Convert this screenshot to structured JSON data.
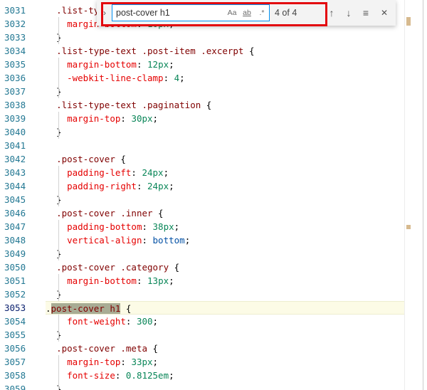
{
  "editor": {
    "lines": [
      {
        "n": "3031",
        "parts": [
          {
            "t": "  "
          },
          {
            "t": ".list-ty",
            "c": "sel"
          }
        ]
      },
      {
        "n": "3032",
        "parts": [
          {
            "t": "    "
          },
          {
            "t": "margin-bottom",
            "c": "prop"
          },
          {
            "t": ": "
          },
          {
            "t": "10px",
            "c": "num"
          },
          {
            "t": ";"
          }
        ]
      },
      {
        "n": "3033",
        "parts": [
          {
            "t": "  }"
          }
        ]
      },
      {
        "n": "3034",
        "parts": [
          {
            "t": "  "
          },
          {
            "t": ".list-type-text .post-item .excerpt",
            "c": "sel"
          },
          {
            "t": " {"
          }
        ]
      },
      {
        "n": "3035",
        "parts": [
          {
            "t": "    "
          },
          {
            "t": "margin-bottom",
            "c": "prop"
          },
          {
            "t": ": "
          },
          {
            "t": "12px",
            "c": "num"
          },
          {
            "t": ";"
          }
        ]
      },
      {
        "n": "3036",
        "parts": [
          {
            "t": "    "
          },
          {
            "t": "-webkit-line-clamp",
            "c": "prop"
          },
          {
            "t": ": "
          },
          {
            "t": "4",
            "c": "num"
          },
          {
            "t": ";"
          }
        ]
      },
      {
        "n": "3037",
        "parts": [
          {
            "t": "  }"
          }
        ]
      },
      {
        "n": "3038",
        "parts": [
          {
            "t": "  "
          },
          {
            "t": ".list-type-text .pagination",
            "c": "sel"
          },
          {
            "t": " {"
          }
        ]
      },
      {
        "n": "3039",
        "parts": [
          {
            "t": "    "
          },
          {
            "t": "margin-top",
            "c": "prop"
          },
          {
            "t": ": "
          },
          {
            "t": "30px",
            "c": "num"
          },
          {
            "t": ";"
          }
        ]
      },
      {
        "n": "3040",
        "parts": [
          {
            "t": "  }"
          }
        ]
      },
      {
        "n": "3041",
        "parts": [
          {
            "t": ""
          }
        ]
      },
      {
        "n": "3042",
        "parts": [
          {
            "t": "  "
          },
          {
            "t": ".post-cover",
            "c": "sel"
          },
          {
            "t": " {"
          }
        ]
      },
      {
        "n": "3043",
        "parts": [
          {
            "t": "    "
          },
          {
            "t": "padding-left",
            "c": "prop"
          },
          {
            "t": ": "
          },
          {
            "t": "24px",
            "c": "num"
          },
          {
            "t": ";"
          }
        ]
      },
      {
        "n": "3044",
        "parts": [
          {
            "t": "    "
          },
          {
            "t": "padding-right",
            "c": "prop"
          },
          {
            "t": ": "
          },
          {
            "t": "24px",
            "c": "num"
          },
          {
            "t": ";"
          }
        ]
      },
      {
        "n": "3045",
        "parts": [
          {
            "t": "  }"
          }
        ]
      },
      {
        "n": "3046",
        "parts": [
          {
            "t": "  "
          },
          {
            "t": ".post-cover .inner",
            "c": "sel"
          },
          {
            "t": " {"
          }
        ]
      },
      {
        "n": "3047",
        "parts": [
          {
            "t": "    "
          },
          {
            "t": "padding-bottom",
            "c": "prop"
          },
          {
            "t": ": "
          },
          {
            "t": "38px",
            "c": "num"
          },
          {
            "t": ";"
          }
        ]
      },
      {
        "n": "3048",
        "parts": [
          {
            "t": "    "
          },
          {
            "t": "vertical-align",
            "c": "prop"
          },
          {
            "t": ": "
          },
          {
            "t": "bottom",
            "c": "kw"
          },
          {
            "t": ";"
          }
        ]
      },
      {
        "n": "3049",
        "parts": [
          {
            "t": "  }"
          }
        ]
      },
      {
        "n": "3050",
        "parts": [
          {
            "t": "  "
          },
          {
            "t": ".post-cover .category",
            "c": "sel"
          },
          {
            "t": " {"
          }
        ]
      },
      {
        "n": "3051",
        "parts": [
          {
            "t": "    "
          },
          {
            "t": "margin-bottom",
            "c": "prop"
          },
          {
            "t": ": "
          },
          {
            "t": "13px",
            "c": "num"
          },
          {
            "t": ";"
          }
        ]
      },
      {
        "n": "3052",
        "parts": [
          {
            "t": "  }"
          }
        ]
      },
      {
        "n": "3053",
        "current": true,
        "parts": [
          {
            "t": "."
          },
          {
            "t": "post-cover h1",
            "c": "sel",
            "m": true
          },
          {
            "t": " {"
          }
        ]
      },
      {
        "n": "3054",
        "parts": [
          {
            "t": "    "
          },
          {
            "t": "font-weight",
            "c": "prop"
          },
          {
            "t": ": "
          },
          {
            "t": "300",
            "c": "num"
          },
          {
            "t": ";"
          }
        ]
      },
      {
        "n": "3055",
        "parts": [
          {
            "t": "  }"
          }
        ]
      },
      {
        "n": "3056",
        "parts": [
          {
            "t": "  "
          },
          {
            "t": ".post-cover .meta",
            "c": "sel"
          },
          {
            "t": " {"
          }
        ]
      },
      {
        "n": "3057",
        "parts": [
          {
            "t": "    "
          },
          {
            "t": "margin-top",
            "c": "prop"
          },
          {
            "t": ": "
          },
          {
            "t": "33px",
            "c": "num"
          },
          {
            "t": ";"
          }
        ]
      },
      {
        "n": "3058",
        "parts": [
          {
            "t": "    "
          },
          {
            "t": "font-size",
            "c": "prop"
          },
          {
            "t": ": "
          },
          {
            "t": "0.8125em",
            "c": "num"
          },
          {
            "t": ";"
          }
        ]
      },
      {
        "n": "3059",
        "parts": [
          {
            "t": "  }"
          }
        ]
      }
    ],
    "colors": {
      "selector": "#800000",
      "property": "#e50000",
      "number": "#098658",
      "keyword": "#0451a5",
      "line_number": "#237893",
      "match_bg": "#a8ac94"
    }
  },
  "find": {
    "toggle_icon": "chevron-right-icon",
    "query": "post-cover h1",
    "opt_case": "Aa",
    "opt_word": "ab",
    "opt_regex": ".*",
    "count": "4 of 4",
    "prev_icon": "↑",
    "next_icon": "↓",
    "selection_icon": "≡",
    "close_icon": "✕",
    "highlight_color": "#e3060e"
  }
}
